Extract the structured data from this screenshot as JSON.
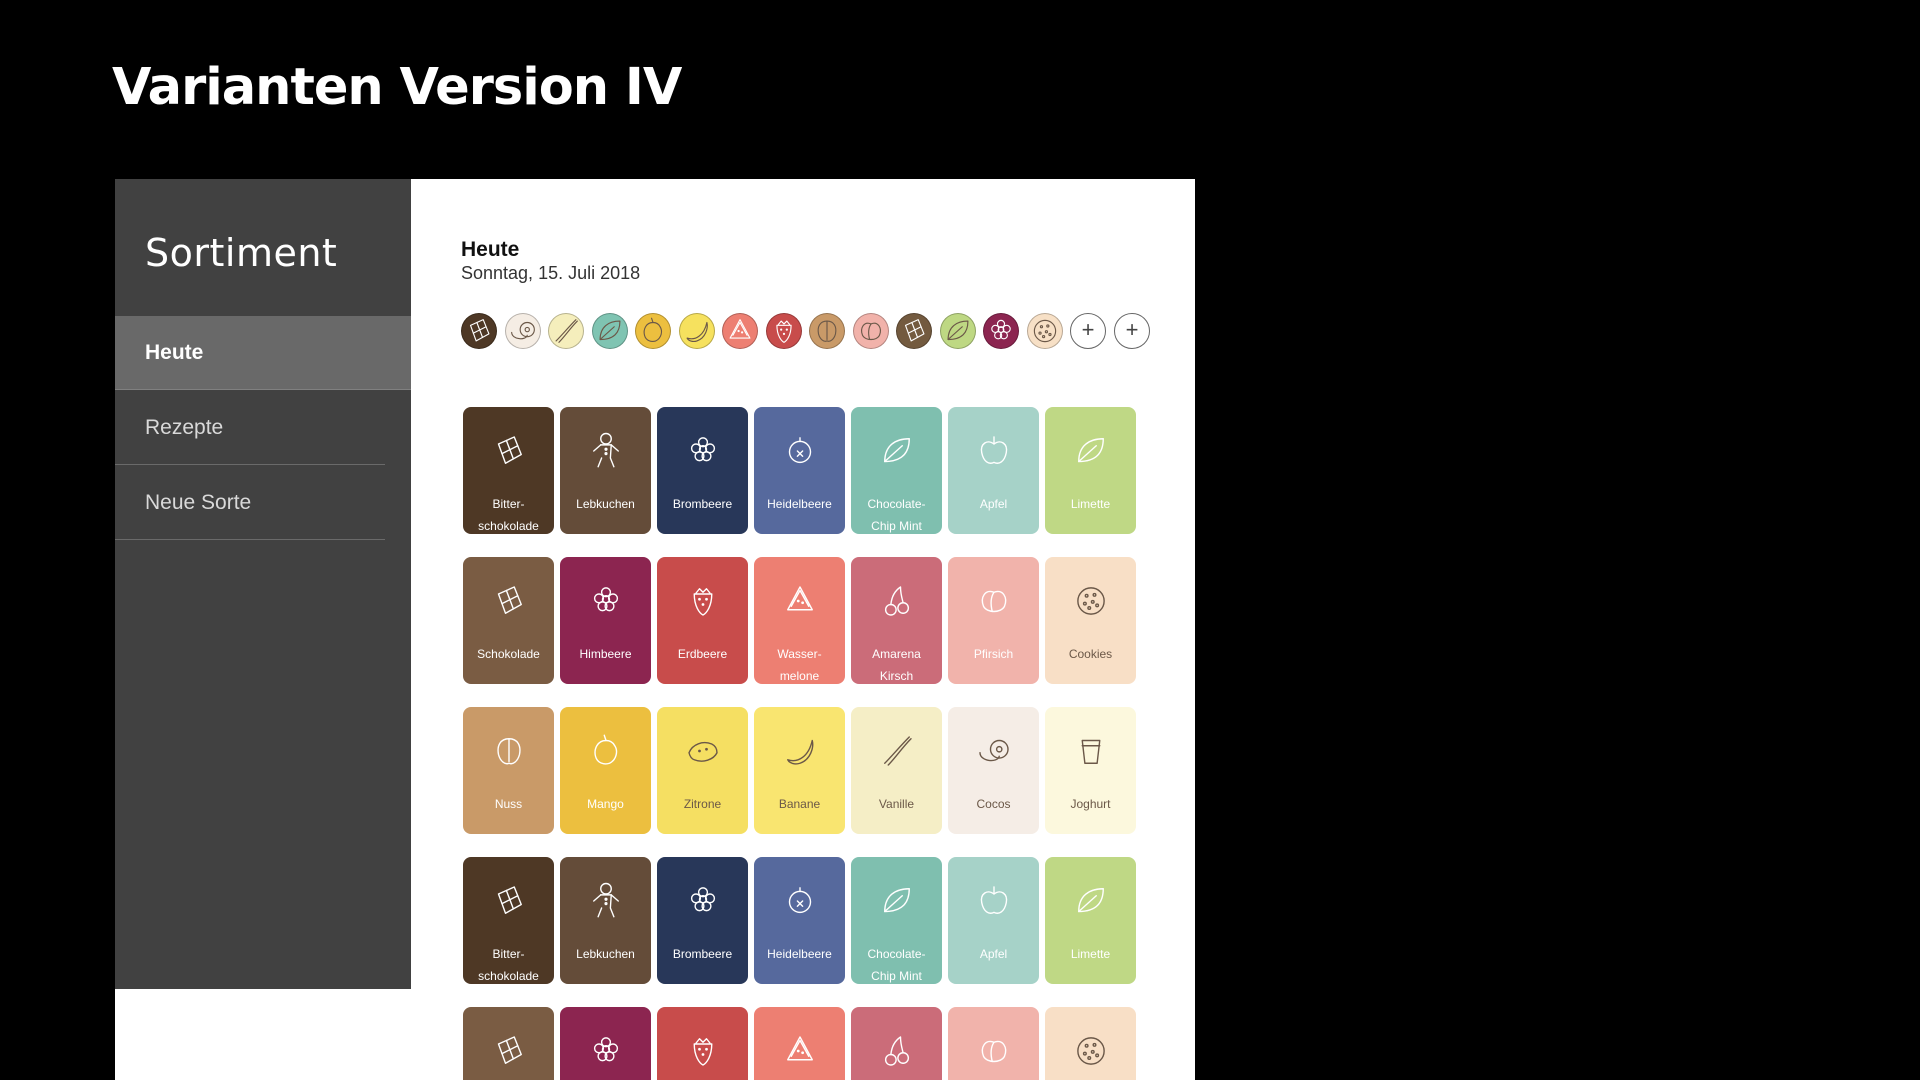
{
  "slide": {
    "title": "Varianten Version IV"
  },
  "sidebar": {
    "brand": "Sortiment",
    "items": [
      {
        "label": "Heute",
        "active": true
      },
      {
        "label": "Rezepte",
        "active": false
      },
      {
        "label": "Neue Sorte",
        "active": false
      }
    ]
  },
  "main": {
    "heading": "Heute",
    "date": "Sonntag, 15. Juli 2018",
    "selection_dots": [
      {
        "icon": "chocolate-icon",
        "color": "#4e3825"
      },
      {
        "icon": "coconut-icon",
        "color": "#f5ede4"
      },
      {
        "icon": "vanilla-icon",
        "color": "#f5eebc"
      },
      {
        "icon": "leaf-icon",
        "color": "#7fc4b2"
      },
      {
        "icon": "mango-icon",
        "color": "#ecbf3f"
      },
      {
        "icon": "banana-icon",
        "color": "#f6e15e"
      },
      {
        "icon": "watermelon-icon",
        "color": "#ed7f72"
      },
      {
        "icon": "strawberry-icon",
        "color": "#c84c4b"
      },
      {
        "icon": "nut-icon",
        "color": "#c99a68"
      },
      {
        "icon": "peach-icon",
        "color": "#f1b2aa"
      },
      {
        "icon": "chocolate-icon",
        "color": "#735a3f"
      },
      {
        "icon": "leaf-icon",
        "color": "#bed883"
      },
      {
        "icon": "berry-icon",
        "color": "#8c2550"
      },
      {
        "icon": "cookie-icon",
        "color": "#f7e0c6"
      }
    ],
    "add_buttons": [
      "+",
      "+"
    ],
    "tile_rows": [
      [
        {
          "label": [
            "Bitter-",
            "schokolade"
          ],
          "icon": "chocolate-icon",
          "bg": "#4e3825",
          "fg": "#ffffff"
        },
        {
          "label": [
            "Lebkuchen"
          ],
          "icon": "gingerbread-icon",
          "bg": "#644c39",
          "fg": "#ffffff"
        },
        {
          "label": [
            "Brombeere"
          ],
          "icon": "berry-icon",
          "bg": "#283759",
          "fg": "#ffffff"
        },
        {
          "label": [
            "Heidelbeere"
          ],
          "icon": "blueberry-icon",
          "bg": "#56699d",
          "fg": "#ffffff"
        },
        {
          "label": [
            "Chocolate-",
            "Chip Mint"
          ],
          "icon": "leaf-icon",
          "bg": "#7fbfaf",
          "fg": "#ffffff"
        },
        {
          "label": [
            "Apfel"
          ],
          "icon": "apple-icon",
          "bg": "#a6d2c8",
          "fg": "#ffffff"
        },
        {
          "label": [
            "Limette"
          ],
          "icon": "leaf-icon",
          "bg": "#bfd885",
          "fg": "#ffffff"
        }
      ],
      [
        {
          "label": [
            "Schokolade"
          ],
          "icon": "chocolate-icon",
          "bg": "#7a5c43",
          "fg": "#ffffff"
        },
        {
          "label": [
            "Himbeere"
          ],
          "icon": "berry-icon",
          "bg": "#8c2550",
          "fg": "#ffffff"
        },
        {
          "label": [
            "Erdbeere"
          ],
          "icon": "strawberry-icon",
          "bg": "#c84c4b",
          "fg": "#ffffff"
        },
        {
          "label": [
            "Wasser-",
            "melone"
          ],
          "icon": "watermelon-icon",
          "bg": "#ed7f72",
          "fg": "#ffffff"
        },
        {
          "label": [
            "Amarena",
            "Kirsch"
          ],
          "icon": "cherry-icon",
          "bg": "#cb6c79",
          "fg": "#ffffff"
        },
        {
          "label": [
            "Pfirsich"
          ],
          "icon": "peach-icon",
          "bg": "#f1b3ab",
          "fg": "#ffffff"
        },
        {
          "label": [
            "Cookies"
          ],
          "icon": "cookie-icon",
          "bg": "#f8dfc6",
          "fg": "#6b5848"
        }
      ],
      [
        {
          "label": [
            "Nuss"
          ],
          "icon": "nut-icon",
          "bg": "#c99a68",
          "fg": "#ffffff"
        },
        {
          "label": [
            "Mango"
          ],
          "icon": "mango-icon",
          "bg": "#ecbf3f",
          "fg": "#ffffff"
        },
        {
          "label": [
            "Zitrone"
          ],
          "icon": "lemon-icon",
          "bg": "#f5df62",
          "fg": "#6b5848"
        },
        {
          "label": [
            "Banane"
          ],
          "icon": "banana-icon",
          "bg": "#f9e570",
          "fg": "#6b5848"
        },
        {
          "label": [
            "Vanille"
          ],
          "icon": "vanilla-icon",
          "bg": "#f5eec6",
          "fg": "#6b5848"
        },
        {
          "label": [
            "Cocos"
          ],
          "icon": "coconut-icon",
          "bg": "#f5ede6",
          "fg": "#6b5848"
        },
        {
          "label": [
            "Joghurt"
          ],
          "icon": "yogurt-icon",
          "bg": "#fcf8dd",
          "fg": "#6b5848"
        }
      ],
      [
        {
          "label": [
            "Bitter-",
            "schokolade"
          ],
          "icon": "chocolate-icon",
          "bg": "#4e3825",
          "fg": "#ffffff"
        },
        {
          "label": [
            "Lebkuchen"
          ],
          "icon": "gingerbread-icon",
          "bg": "#644c39",
          "fg": "#ffffff"
        },
        {
          "label": [
            "Brombeere"
          ],
          "icon": "berry-icon",
          "bg": "#283759",
          "fg": "#ffffff"
        },
        {
          "label": [
            "Heidelbeere"
          ],
          "icon": "blueberry-icon",
          "bg": "#56699d",
          "fg": "#ffffff"
        },
        {
          "label": [
            "Chocolate-",
            "Chip Mint"
          ],
          "icon": "leaf-icon",
          "bg": "#7fbfaf",
          "fg": "#ffffff"
        },
        {
          "label": [
            "Apfel"
          ],
          "icon": "apple-icon",
          "bg": "#a6d2c8",
          "fg": "#ffffff"
        },
        {
          "label": [
            "Limette"
          ],
          "icon": "leaf-icon",
          "bg": "#bfd885",
          "fg": "#ffffff"
        }
      ],
      [
        {
          "label": [],
          "icon": "chocolate-icon",
          "bg": "#7a5c43",
          "fg": "#ffffff"
        },
        {
          "label": [],
          "icon": "berry-icon",
          "bg": "#8c2550",
          "fg": "#ffffff"
        },
        {
          "label": [],
          "icon": "strawberry-icon",
          "bg": "#c84c4b",
          "fg": "#ffffff"
        },
        {
          "label": [],
          "icon": "watermelon-icon",
          "bg": "#ed7f72",
          "fg": "#ffffff"
        },
        {
          "label": [],
          "icon": "cherry-icon",
          "bg": "#cb6c79",
          "fg": "#ffffff"
        },
        {
          "label": [],
          "icon": "peach-icon",
          "bg": "#f1b3ab",
          "fg": "#ffffff"
        },
        {
          "label": [],
          "icon": "cookie-icon",
          "bg": "#f8dfc6",
          "fg": "#6b5848"
        }
      ]
    ]
  }
}
